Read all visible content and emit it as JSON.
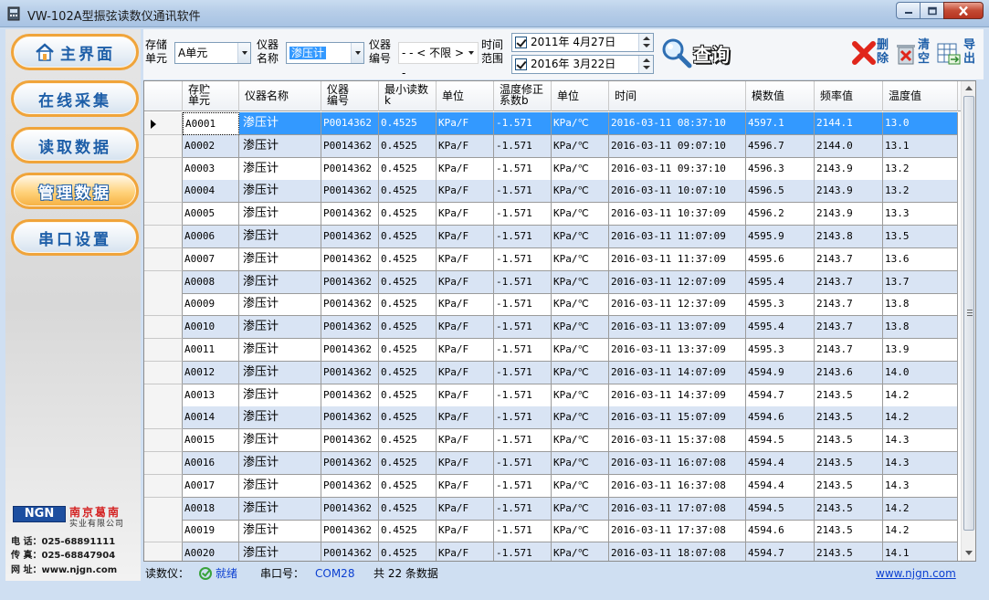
{
  "window": {
    "title": "VW-102A型振弦读数仪通讯软件"
  },
  "sidebar": {
    "items": [
      {
        "label": "主界面",
        "active": false
      },
      {
        "label": "在线采集",
        "active": false
      },
      {
        "label": "读取数据",
        "active": false
      },
      {
        "label": "管理数据",
        "active": true
      },
      {
        "label": "串口设置",
        "active": false
      }
    ],
    "logo": {
      "mark": "NGN",
      "name": "南京葛南",
      "sub": "实业有限公司"
    },
    "contact": {
      "phone": "电 话：025-68891111",
      "fax": "传 真：025-68847904",
      "web": "网 址：www.njgn.com"
    }
  },
  "toolbar": {
    "storage_label": "存储\n单元",
    "storage_value": "A单元",
    "instrument_label": "仪器\n名称",
    "instrument_value": "渗压计",
    "code_label": "仪器\n编号",
    "code_value": "- - < 不限 > - -",
    "time_label": "时间\n范围",
    "date_from": "2011年  4月27日",
    "date_to": "2016年  3月22日",
    "query_label": "查询",
    "delete_label": "删除",
    "clear_label": "清空",
    "export_label": "导出"
  },
  "colors": {
    "accent": "#3399ff",
    "alt_row": "#d9e4f4",
    "nav_border": "#f0a43a",
    "nav_text": "#1d5ea8"
  },
  "grid": {
    "columns": [
      "存贮\n单元",
      "仪器名称",
      "仪器\n编号",
      "最小读数\nk",
      "单位",
      "温度修正\n系数b",
      "单位",
      "时间",
      "模数值",
      "频率值",
      "温度值"
    ],
    "rows": [
      [
        "A0001",
        "渗压计",
        "P0014362",
        "0.4525",
        "KPa/F",
        "-1.571",
        "KPa/℃",
        "2016-03-11 08:37:10",
        "4597.1",
        "2144.1",
        "13.0"
      ],
      [
        "A0002",
        "渗压计",
        "P0014362",
        "0.4525",
        "KPa/F",
        "-1.571",
        "KPa/℃",
        "2016-03-11 09:07:10",
        "4596.7",
        "2144.0",
        "13.1"
      ],
      [
        "A0003",
        "渗压计",
        "P0014362",
        "0.4525",
        "KPa/F",
        "-1.571",
        "KPa/℃",
        "2016-03-11 09:37:10",
        "4596.3",
        "2143.9",
        "13.2"
      ],
      [
        "A0004",
        "渗压计",
        "P0014362",
        "0.4525",
        "KPa/F",
        "-1.571",
        "KPa/℃",
        "2016-03-11 10:07:10",
        "4596.5",
        "2143.9",
        "13.2"
      ],
      [
        "A0005",
        "渗压计",
        "P0014362",
        "0.4525",
        "KPa/F",
        "-1.571",
        "KPa/℃",
        "2016-03-11 10:37:09",
        "4596.2",
        "2143.9",
        "13.3"
      ],
      [
        "A0006",
        "渗压计",
        "P0014362",
        "0.4525",
        "KPa/F",
        "-1.571",
        "KPa/℃",
        "2016-03-11 11:07:09",
        "4595.9",
        "2143.8",
        "13.5"
      ],
      [
        "A0007",
        "渗压计",
        "P0014362",
        "0.4525",
        "KPa/F",
        "-1.571",
        "KPa/℃",
        "2016-03-11 11:37:09",
        "4595.6",
        "2143.7",
        "13.6"
      ],
      [
        "A0008",
        "渗压计",
        "P0014362",
        "0.4525",
        "KPa/F",
        "-1.571",
        "KPa/℃",
        "2016-03-11 12:07:09",
        "4595.4",
        "2143.7",
        "13.7"
      ],
      [
        "A0009",
        "渗压计",
        "P0014362",
        "0.4525",
        "KPa/F",
        "-1.571",
        "KPa/℃",
        "2016-03-11 12:37:09",
        "4595.3",
        "2143.7",
        "13.8"
      ],
      [
        "A0010",
        "渗压计",
        "P0014362",
        "0.4525",
        "KPa/F",
        "-1.571",
        "KPa/℃",
        "2016-03-11 13:07:09",
        "4595.4",
        "2143.7",
        "13.8"
      ],
      [
        "A0011",
        "渗压计",
        "P0014362",
        "0.4525",
        "KPa/F",
        "-1.571",
        "KPa/℃",
        "2016-03-11 13:37:09",
        "4595.3",
        "2143.7",
        "13.9"
      ],
      [
        "A0012",
        "渗压计",
        "P0014362",
        "0.4525",
        "KPa/F",
        "-1.571",
        "KPa/℃",
        "2016-03-11 14:07:09",
        "4594.9",
        "2143.6",
        "14.0"
      ],
      [
        "A0013",
        "渗压计",
        "P0014362",
        "0.4525",
        "KPa/F",
        "-1.571",
        "KPa/℃",
        "2016-03-11 14:37:09",
        "4594.7",
        "2143.5",
        "14.2"
      ],
      [
        "A0014",
        "渗压计",
        "P0014362",
        "0.4525",
        "KPa/F",
        "-1.571",
        "KPa/℃",
        "2016-03-11 15:07:09",
        "4594.6",
        "2143.5",
        "14.2"
      ],
      [
        "A0015",
        "渗压计",
        "P0014362",
        "0.4525",
        "KPa/F",
        "-1.571",
        "KPa/℃",
        "2016-03-11 15:37:08",
        "4594.5",
        "2143.5",
        "14.3"
      ],
      [
        "A0016",
        "渗压计",
        "P0014362",
        "0.4525",
        "KPa/F",
        "-1.571",
        "KPa/℃",
        "2016-03-11 16:07:08",
        "4594.4",
        "2143.5",
        "14.3"
      ],
      [
        "A0017",
        "渗压计",
        "P0014362",
        "0.4525",
        "KPa/F",
        "-1.571",
        "KPa/℃",
        "2016-03-11 16:37:08",
        "4594.4",
        "2143.5",
        "14.3"
      ],
      [
        "A0018",
        "渗压计",
        "P0014362",
        "0.4525",
        "KPa/F",
        "-1.571",
        "KPa/℃",
        "2016-03-11 17:07:08",
        "4594.5",
        "2143.5",
        "14.2"
      ],
      [
        "A0019",
        "渗压计",
        "P0014362",
        "0.4525",
        "KPa/F",
        "-1.571",
        "KPa/℃",
        "2016-03-11 17:37:08",
        "4594.6",
        "2143.5",
        "14.2"
      ],
      [
        "A0020",
        "渗压计",
        "P0014362",
        "0.4525",
        "KPa/F",
        "-1.571",
        "KPa/℃",
        "2016-03-11 18:07:08",
        "4594.7",
        "2143.5",
        "14.1"
      ]
    ]
  },
  "status": {
    "reader_label": "读数仪：",
    "reader_state": "就绪",
    "port_label": "串口号：",
    "port_value": "COM28",
    "count": "共 22 条数据",
    "website": "www.njgn.com"
  }
}
